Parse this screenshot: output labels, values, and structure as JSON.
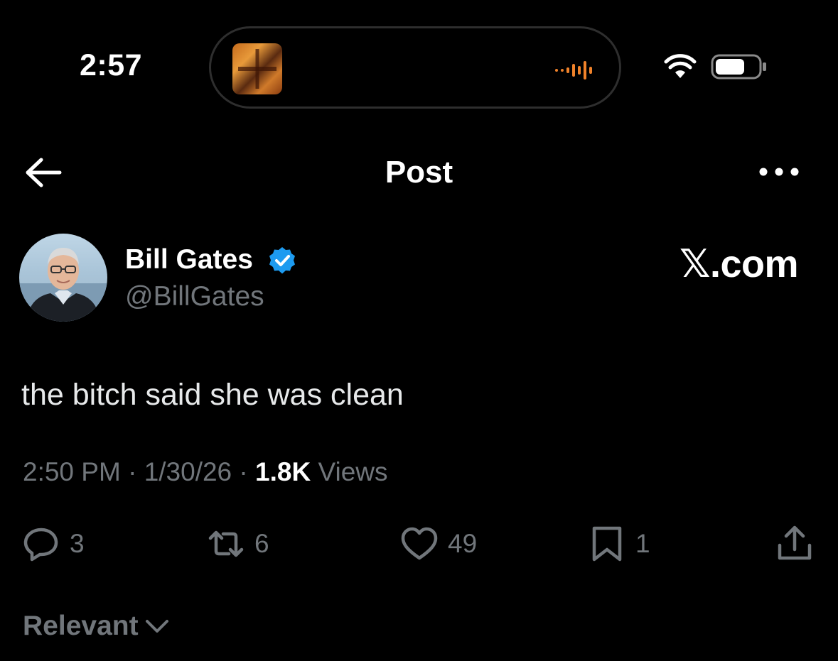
{
  "status_bar": {
    "time": "2:57",
    "wifi_icon": "wifi-icon",
    "battery_icon": "battery-icon",
    "island_accent_color": "#f0822a"
  },
  "header": {
    "title": "Post",
    "back_icon": "arrow-left-icon",
    "more_icon": "more-horizontal-icon"
  },
  "author": {
    "name": "Bill Gates",
    "handle": "@BillGates",
    "verified": true,
    "verified_color": "#1d9bf0"
  },
  "watermark": "𝕏.com",
  "post": {
    "text": "the bitch said she was clean",
    "time": "2:50 PM",
    "date": "1/30/26",
    "views_count": "1.8K",
    "views_label": "Views"
  },
  "actions": {
    "reply_count": "3",
    "repost_count": "6",
    "like_count": "49",
    "bookmark_count": "1"
  },
  "replies_sort": {
    "label": "Relevant"
  },
  "colors": {
    "background": "#000000",
    "text_primary": "#e7e9ea",
    "text_secondary": "#71767b"
  }
}
